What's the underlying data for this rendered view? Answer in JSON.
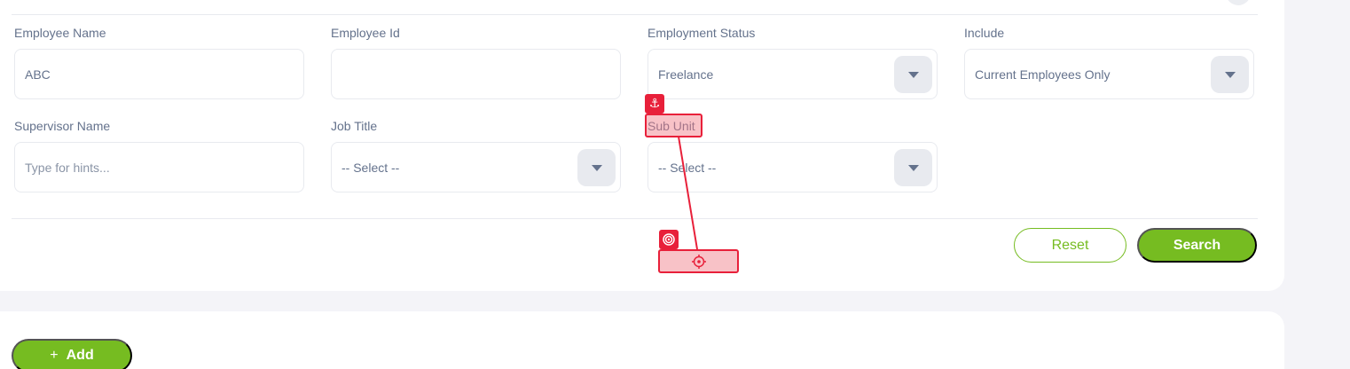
{
  "filters": {
    "employee_name": {
      "label": "Employee Name",
      "value": "ABC"
    },
    "employee_id": {
      "label": "Employee Id",
      "value": ""
    },
    "employment_status": {
      "label": "Employment Status",
      "value": "Freelance"
    },
    "include": {
      "label": "Include",
      "value": "Current Employees Only"
    },
    "supervisor_name": {
      "label": "Supervisor Name",
      "placeholder": "Type for hints..."
    },
    "job_title": {
      "label": "Job Title",
      "value": "-- Select --"
    },
    "sub_unit": {
      "label": "Sub Unit",
      "value": "-- Select --"
    }
  },
  "actions": {
    "reset_label": "Reset",
    "search_label": "Search",
    "add_label": "Add",
    "add_icon": "plus-icon"
  },
  "annotation": {
    "anchor_icon": "anchor-icon",
    "target_icon": "target-icon",
    "crosshair_icon": "crosshair-icon",
    "color": "#e8203a"
  },
  "theme": {
    "accent": "#76bc21",
    "text": "#64728c",
    "background": "#f4f4f8"
  }
}
